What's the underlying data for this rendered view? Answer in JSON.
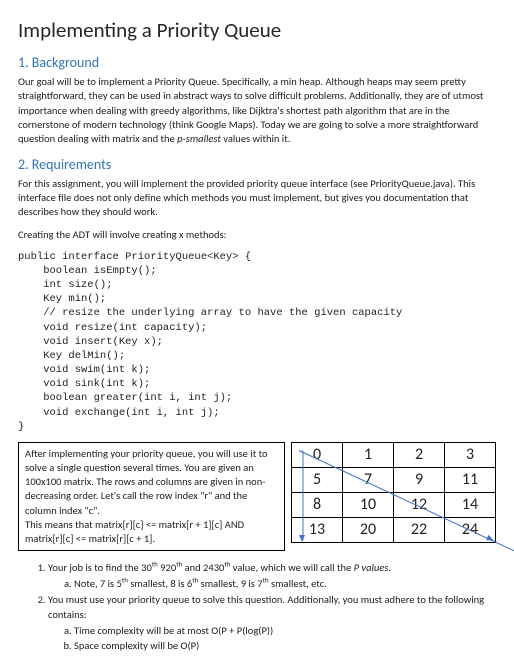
{
  "title": "Implementing a Priority Queue",
  "s1": {
    "heading": "1. Background",
    "p1a": "Our goal will be to implement a Priority Queue. Specifically, a min heap. Although heaps may seem pretty straightforward, they can be used in abstract ways to solve difficult problems. Additionally, they are of utmost importance when dealing with greedy algorithms, like Dijktra's shortest path algorithm that are in the cornerstone of modern technology (think Google Maps). Today we are going to solve a more straightforward question dealing with matrix and the ",
    "p1em": "p-smallest",
    "p1b": " values within it."
  },
  "s2": {
    "heading": "2. Requirements",
    "p1": "For this assignment, you will implement the provided priority queue interface (see PriorityQueue.java). This interface file does not only define which methods you must implement, but gives you documentation that describes how they should work.",
    "p2": "Creating the ADT will involve creating x methods:",
    "code": "public interface PriorityQueue<Key> {\n    boolean isEmpty();\n    int size();\n    Key min();\n    // resize the underlying array to have the given capacity\n    void resize(int capacity);\n    void insert(Key x);\n    Key delMin();\n    void swim(int k);\n    void sink(int k);\n    boolean greater(int i, int j);\n    void exchange(int i, int j);\n}"
  },
  "box": {
    "t1": "After implementing your priority queue, you will use it to solve a single question several times. You are given an 100x100 matrix. The rows and columns are given in non-decreasing order. Let's call the row index \"r\" and the column index \"c\".",
    "t2": "This means that matrix[r][c] <= matrix[r + 1][c] AND matrix[r][c] <= matrix[r][c + 1]."
  },
  "matrix": {
    "r0": {
      "c0": "0",
      "c1": "1",
      "c2": "2",
      "c3": "3"
    },
    "r1": {
      "c0": "5",
      "c1": "7",
      "c2": "9",
      "c3": "11"
    },
    "r2": {
      "c0": "8",
      "c1": "10",
      "c2": "12",
      "c3": "14"
    },
    "r3": {
      "c0": "13",
      "c1": "20",
      "c2": "22",
      "c3": "24"
    }
  },
  "list": {
    "i1a": "Your job is to find the 30",
    "i1sup1": "th",
    "i1b": " 920",
    "i1sup2": "th",
    "i1c": " and 2430",
    "i1sup3": "th",
    "i1d": " value, which we will call the ",
    "i1em": "P values",
    "i1e": ".",
    "i1a_sub": "Note, 7 is 5",
    "i1a_sup1": "th",
    "i1a_sub2": " smallest, 8 is 6",
    "i1a_sup2": "th",
    "i1a_sub3": " smallest, 9 is 7",
    "i1a_sup3": "th",
    "i1a_sub4": " smallest, etc.",
    "i2": "You must use your priority queue to solve this question. Additionally, you must adhere to the following contains:",
    "i2a": "Time complexity will be at most O(P + P(log(P))",
    "i2b": "Space complexity will be O(P)"
  }
}
